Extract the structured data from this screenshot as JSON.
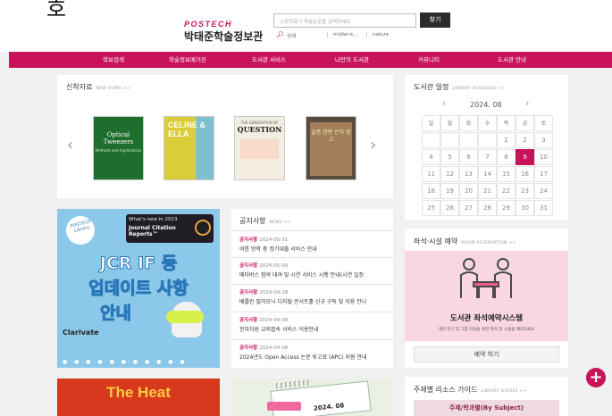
{
  "corner_glyph": "호",
  "logo": {
    "en": "POSTECH",
    "ko": "박태준학술정보관"
  },
  "search": {
    "placeholder": "소장자료나 학술논문을 검색하세요",
    "button": "찾기",
    "scope": "상세",
    "quick_links": [
      "müller-k…",
      "nature"
    ]
  },
  "nav": [
    "학보검색",
    "학술정보매거진",
    "도서관 서비스",
    "나만의 도서관",
    "커뮤니티",
    "도서관 안내"
  ],
  "new_items": {
    "title": "신착자료",
    "subtitle": "NEW ITEMS >>",
    "books": [
      {
        "title": "Optical Tweezers",
        "sub": "Methods and Applications"
      },
      {
        "title": "CELINE & ELLA"
      },
      {
        "title": "QUESTION",
        "sub": "THE GENERATION OF"
      },
      {
        "title": "슬픔 한편 은하 광고"
      }
    ]
  },
  "schedule": {
    "title": "도서관 일정",
    "subtitle": "LIBRARY SCHEDULE >>",
    "month": "2024. 08",
    "weekdays": [
      "일",
      "월",
      "화",
      "수",
      "목",
      "금",
      "토"
    ],
    "weeks": [
      [
        "",
        "",
        "",
        "",
        "1",
        "2",
        "3"
      ],
      [
        "4",
        "5",
        "6",
        "7",
        "8",
        "9",
        "10"
      ],
      [
        "11",
        "12",
        "13",
        "14",
        "15",
        "16",
        "17"
      ],
      [
        "18",
        "19",
        "20",
        "21",
        "22",
        "23",
        "24"
      ],
      [
        "25",
        "26",
        "27",
        "28",
        "29",
        "30",
        "31"
      ]
    ],
    "today": "9"
  },
  "banner": {
    "whats_new": "What's new in 2023",
    "jcr_brand": "Journal Citation Reports™",
    "line1": "JCR IF 등",
    "line2": "업데이트 사항",
    "line3": "안내",
    "clarivate": "Clarivate",
    "sticker": "POSTECH Library"
  },
  "notices": {
    "title": "공지사항",
    "subtitle": "NEWS >>",
    "items": [
      {
        "cat": "공지사항",
        "date": "2024-05-31",
        "text": "여름 방학 중 정기대출 서비스 안내"
      },
      {
        "cat": "공지사항",
        "date": "2024-05-09",
        "text": "메타버스 참여 대여 및 시연 서비스 시행 안내(시연 일정"
      },
      {
        "cat": "공지사항",
        "date": "2024-04-18",
        "text": "베를린 필하모닉 디지털 콘서트홀 신규 구독 및 이용 안나"
      },
      {
        "cat": "공지사항",
        "date": "2024-04-08",
        "text": "전자자원 교외접속 서비스 이용안내"
      },
      {
        "cat": "공지사항",
        "date": "2024-04-08",
        "text": "2024년도 Open Access 논문 투고료 (APC) 지원 안내"
      }
    ]
  },
  "reservation": {
    "title": "좌석·시설 예약",
    "subtitle": "ROOM RESERVATION >>",
    "system": "도서관 좌석예약시스템",
    "desc": "개인 연구 및 그룹 미팅을 위한 좌석 및 시설을 예약하세요",
    "button": "예약 하기"
  },
  "guides": {
    "title": "주제별 리소스 가이드",
    "subtitle": "LIBRARY GUIDES >>",
    "button": "주제/학과별(By Subject)"
  },
  "bottom_banner": {
    "text": "The Heat"
  },
  "calendar_banner": {
    "date": "2024. 08"
  },
  "colors": {
    "brand": "#c8135a",
    "accent_yellow": "#f0d419",
    "banner_blue": "#8cc8ea"
  }
}
